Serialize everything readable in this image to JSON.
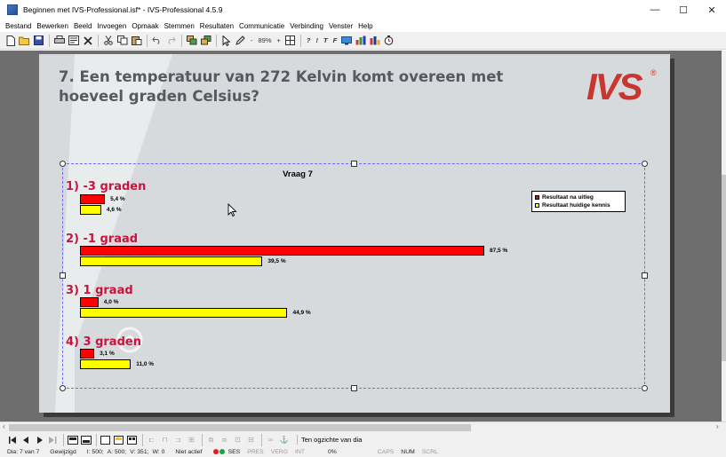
{
  "window": {
    "title": "Beginnen met IVS-Professional.isf* - IVS-Professional 4.5.9",
    "minimize": "—",
    "maximize": "☐",
    "close": "✕"
  },
  "menu": [
    "Bestand",
    "Bewerken",
    "Beeld",
    "Invoegen",
    "Opmaak",
    "Stemmen",
    "Resultaten",
    "Communicatie",
    "Verbinding",
    "Venster",
    "Help"
  ],
  "toolbar": {
    "zoom_minus": "-",
    "zoom": "89%",
    "zoom_plus": "+",
    "t1": "?",
    "t2": "!",
    "t3": "T",
    "t4": "F"
  },
  "slide": {
    "question": "7. Een temperatuur van 272 Kelvin komt overeen met hoeveel graden Celsius?",
    "logo": "IVS",
    "logo_reg": "®"
  },
  "chart_data": {
    "type": "bar",
    "orientation": "horizontal",
    "title": "Vraag 7",
    "categories": [
      "1) -3 graden",
      "2) -1 graad",
      "3) 1 graad",
      "4) 3 graden"
    ],
    "series": [
      {
        "name": "Resultaat na uitleg",
        "color": "#ff0000",
        "values": [
          5.4,
          87.5,
          4.0,
          3.1
        ],
        "labels": [
          "5,4 %",
          "87,5 %",
          "4,0 %",
          "3,1 %"
        ]
      },
      {
        "name": "Resultaat huidige kennis",
        "color": "#ffff00",
        "values": [
          4.6,
          39.5,
          44.9,
          11.0
        ],
        "labels": [
          "4,6 %",
          "39,5 %",
          "44,9 %",
          "11,0 %"
        ]
      }
    ],
    "xlim": [
      0,
      100
    ],
    "legend": "top-right",
    "grid": false
  },
  "navbar": {
    "view_label": "Ten ogzichte van dia"
  },
  "status": {
    "slide": "Dia: 7 van 7",
    "modified": "Gewijzigd",
    "i": "I: 500;",
    "a": "A: 500;",
    "v": "V: 351;",
    "w": "W: 0",
    "active": "Niet actief",
    "ses": "SES",
    "pres": "PRES",
    "verg": "VERG",
    "int": "INT",
    "pct": "0%",
    "caps": "CAPS",
    "num": "NUM",
    "scrl": "SCRL"
  }
}
